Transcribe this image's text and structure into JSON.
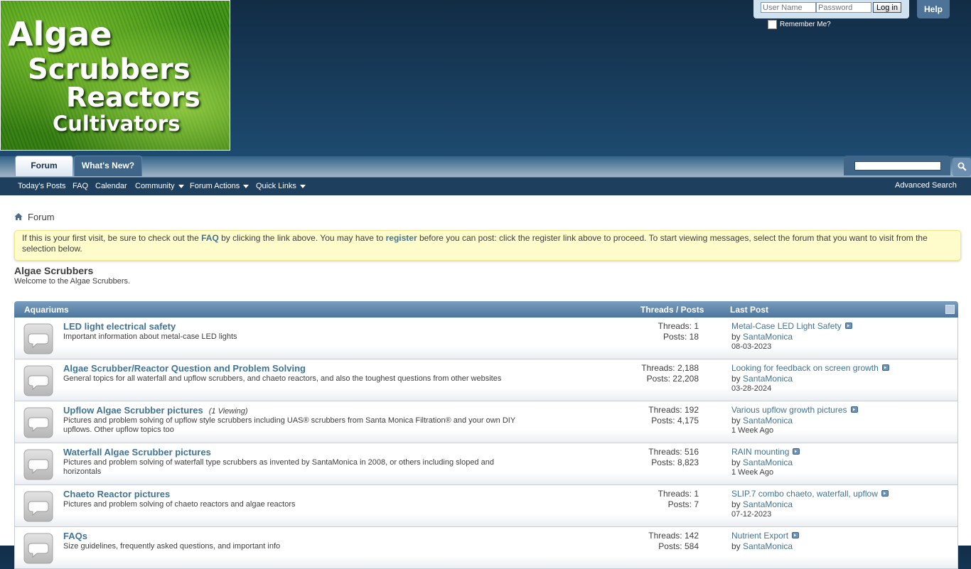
{
  "logo": {
    "line1": "Algae",
    "line2": "Scrubbers",
    "line3": "Reactors",
    "line4": "Cultivators"
  },
  "login": {
    "username_placeholder": "User Name",
    "password_placeholder": "Password",
    "login_label": "Log in",
    "remember_label": "Remember Me?",
    "help_label": "Help"
  },
  "tabs": {
    "forum": "Forum",
    "whats_new": "What's New?"
  },
  "subnav": {
    "todays_posts": "Today's Posts",
    "faq": "FAQ",
    "calendar": "Calendar",
    "community": "Community",
    "forum_actions": "Forum Actions",
    "quick_links": "Quick Links",
    "advanced_search": "Advanced Search"
  },
  "breadcrumb": {
    "current": "Forum"
  },
  "notice": {
    "part1": "If this is your first visit, be sure to check out the ",
    "faq_link": "FAQ",
    "part2": " by clicking the link above. You may have to ",
    "register_link": "register",
    "part3": " before you can post: click the register link above to proceed. To start viewing messages, select the forum that you want to visit from the selection below."
  },
  "category": {
    "title": "Algae Scrubbers",
    "description": "Welcome to the Algae Scrubbers."
  },
  "forum_header": {
    "name": "Aquariums",
    "stats": "Threads / Posts",
    "last_post": "Last Post"
  },
  "forums": [
    {
      "title": "LED light electrical safety",
      "viewing": "",
      "description": "Important information about metal-case LED lights",
      "threads": "Threads: 1",
      "posts": "Posts: 18",
      "last_title": "Metal-Case LED Light Safety",
      "by": "by ",
      "user": "SantaMonica",
      "date": "08-03-2023"
    },
    {
      "title": "Algae Scrubber/Reactor Question and Problem Solving",
      "viewing": "",
      "description": "General topics for all waterfall and upflow scrubbers, and chaeto reactors, and also the toughest questions from other websites",
      "threads": "Threads: 2,188",
      "posts": "Posts: 22,208",
      "last_title": "Looking for feedback on screen growth",
      "by": "by ",
      "user": "SantaMonica",
      "date": "03-28-2024"
    },
    {
      "title": "Upflow Algae Scrubber pictures",
      "viewing": "(1 Viewing)",
      "description": "Pictures and problem solving of upflow style scrubbers including UAS® scrubbers from Santa Monica Filtration® and your own DIY upflows. Other upflow topics too",
      "threads": "Threads: 192",
      "posts": "Posts: 4,175",
      "last_title": "Various upflow growth pictures",
      "by": "by ",
      "user": "SantaMonica",
      "date": "1 Week Ago"
    },
    {
      "title": "Waterfall Algae Scrubber pictures",
      "viewing": "",
      "description": "Pictures and problem solving of waterfall type scrubbers as invented by SantaMonica in 2008, or others including sloped and horizontals",
      "threads": "Threads: 516",
      "posts": "Posts: 8,823",
      "last_title": "RAIN mounting",
      "by": "by ",
      "user": "SantaMonica",
      "date": "1 Week Ago"
    },
    {
      "title": "Chaeto Reactor pictures",
      "viewing": "",
      "description": "Pictures and problem solving of chaeto reactors and algae reactors",
      "threads": "Threads: 1",
      "posts": "Posts: 7",
      "last_title": "SLIP.7 combo chaeto, waterfall, upflow",
      "by": "by ",
      "user": "SantaMonica",
      "date": "07-12-2023"
    },
    {
      "title": "FAQs",
      "viewing": "",
      "description": "Size guidelines, frequently asked questions, and important info",
      "threads": "Threads: 142",
      "posts": "Posts: 584",
      "last_title": "Nutrient Export",
      "by": "by ",
      "user": "SantaMonica",
      "date": ""
    }
  ],
  "colors": {
    "header_bg": "#1d4a6f",
    "link": "#417394",
    "notice_bg": "#fffccc",
    "forum_header": "#5f86ab"
  }
}
